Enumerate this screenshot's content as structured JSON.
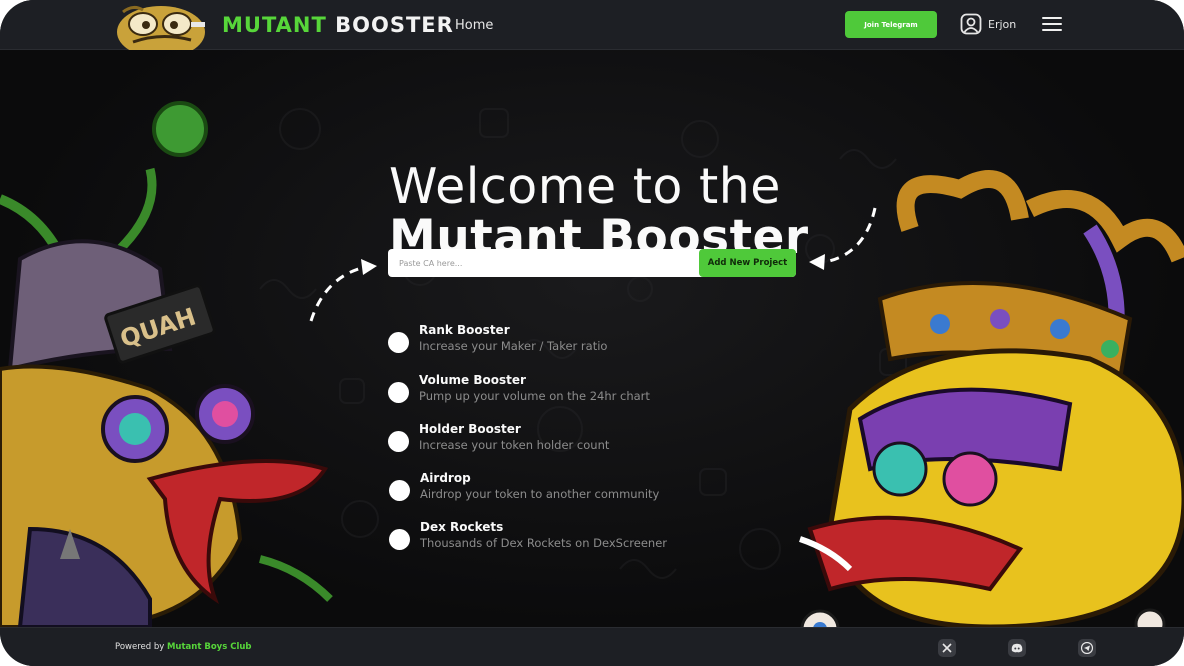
{
  "header": {
    "brand_part1": "MUTANT",
    "brand_part2": "BOOSTER",
    "nav_home": "Home",
    "telegram_button": "Join Telegram",
    "username": "Erjon"
  },
  "hero": {
    "title_line1": "Welcome to the",
    "title_line2": "Mutant Booster",
    "search_placeholder": "Paste CA here...",
    "add_button": "Add New Project"
  },
  "features": [
    {
      "title": "Rank Booster",
      "description": "Increase your Maker / Taker ratio"
    },
    {
      "title": "Volume Booster",
      "description": "Pump up your volume on the 24hr chart"
    },
    {
      "title": "Holder Booster",
      "description": "Increase your token holder count"
    },
    {
      "title": "Airdrop",
      "description": "Airdrop your token to another community"
    },
    {
      "title": "Dex Rockets",
      "description": "Thousands of Dex Rockets on DexScreener"
    }
  ],
  "footer": {
    "powered_prefix": "Powered by",
    "powered_link": "Mutant Boys Club"
  },
  "icons": {
    "social": [
      "x-icon",
      "discord-icon",
      "telegram-icon"
    ]
  },
  "colors": {
    "accent_green": "#4fc93a",
    "bar_bg": "#1d1f24",
    "page_bg": "#0c0c0d"
  }
}
